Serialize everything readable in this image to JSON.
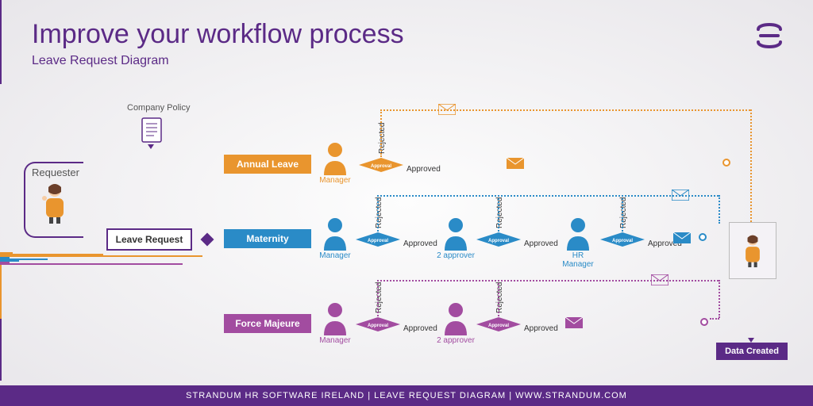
{
  "title": "Improve your workflow process",
  "subtitle": "Leave Request Diagram",
  "doc_label": "Company Policy",
  "requester_label": "Requester",
  "leave_request": "Leave Request",
  "tracks": {
    "annual": {
      "label": "Annual Leave",
      "color": "#e9952e",
      "roles": [
        "Manager"
      ]
    },
    "maternity": {
      "label": "Maternity",
      "color": "#2a8bc7",
      "roles": [
        "Manager",
        "2 approver",
        "HR Manager"
      ]
    },
    "force": {
      "label": "Force Majeure",
      "color": "#a24ca0",
      "roles": [
        "Manager",
        "2 approver"
      ]
    }
  },
  "decision": {
    "pass": "Approved",
    "fail": "Rejected",
    "label": "Approval"
  },
  "data_created": "Data Created",
  "footer": "STRANDUM HR SOFTWARE IRELAND | LEAVE REQUEST DIAGRAM | WWW.STRANDUM.COM"
}
